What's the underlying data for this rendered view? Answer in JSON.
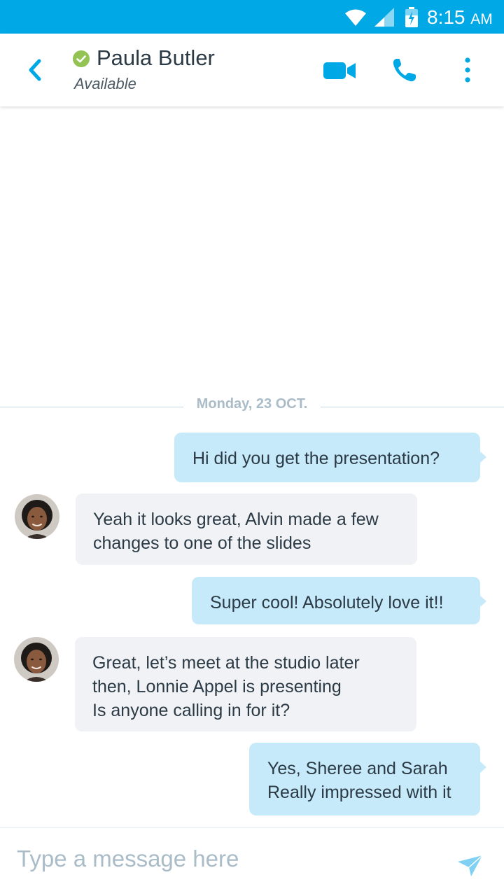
{
  "status_bar": {
    "time": "8:15",
    "ampm": "AM",
    "icons": [
      "wifi-icon",
      "cellular-signal-icon",
      "battery-charging-icon"
    ]
  },
  "header": {
    "contact_name": "Paula Butler",
    "contact_status": "Available",
    "icons": [
      "back-arrow-icon",
      "presence-available-icon",
      "video-call-icon",
      "phone-call-icon",
      "more-options-icon"
    ]
  },
  "date_divider": "Monday, 23 OCT.",
  "messages": [
    {
      "direction": "outgoing",
      "lines": [
        "Hi did you get the presentation?"
      ]
    },
    {
      "direction": "incoming",
      "lines": [
        "Yeah it looks great, Alvin made a few",
        "changes to one of the slides"
      ]
    },
    {
      "direction": "outgoing",
      "lines": [
        "Super cool! Absolutely love it!!"
      ]
    },
    {
      "direction": "incoming",
      "lines": [
        "Great, let’s meet at the studio later",
        "then, Lonnie Appel is presenting",
        "Is anyone calling in for it?"
      ]
    },
    {
      "direction": "outgoing",
      "lines": [
        "Yes, Sheree and Sarah",
        "Really impressed with it"
      ]
    }
  ],
  "composer": {
    "placeholder": "Type a message here",
    "value": ""
  },
  "colors": {
    "status_bar": "#00a8e6",
    "accent": "#00a8e6",
    "presence_available": "#92c353",
    "outgoing_bubble": "#c7eafb",
    "incoming_bubble": "#f1f2f5",
    "send_icon": "#7fd0f3"
  }
}
